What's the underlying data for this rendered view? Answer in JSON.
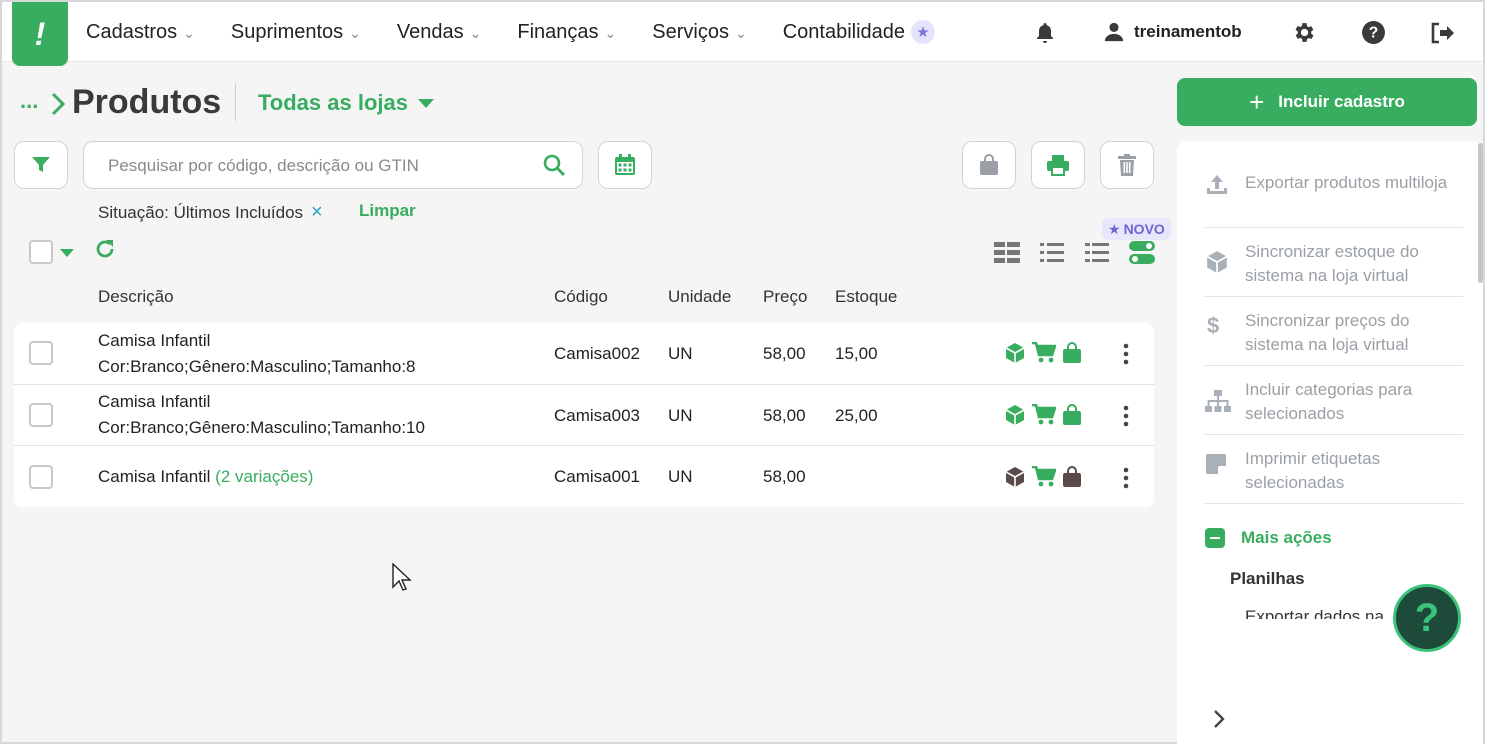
{
  "nav": {
    "logo": "!",
    "menu": [
      {
        "label": "Cadastros"
      },
      {
        "label": "Suprimentos"
      },
      {
        "label": "Vendas"
      },
      {
        "label": "Finanças"
      },
      {
        "label": "Serviços"
      },
      {
        "label": "Contabilidade"
      }
    ],
    "username": "treinamentob"
  },
  "header": {
    "breadcrumb_dots": "...",
    "title": "Produtos",
    "store_select": "Todas as lojas",
    "include_button": "Incluir cadastro"
  },
  "search": {
    "placeholder": "Pesquisar por código, descrição ou GTIN",
    "value": ""
  },
  "filter": {
    "label": "Situação: Últimos Incluídos",
    "remove": "×",
    "clear": "Limpar"
  },
  "badge_new": "NOVO",
  "table": {
    "headers": {
      "description": "Descrição",
      "code": "Código",
      "unit": "Unidade",
      "price": "Preço",
      "stock": "Estoque"
    },
    "rows": [
      {
        "desc1": "Camisa Infantil",
        "desc2": "Cor:Branco;Gênero:Masculino;Tamanho:8",
        "variations": "",
        "code": "Camisa002",
        "unit": "UN",
        "price": "58,00",
        "stock": "15,00"
      },
      {
        "desc1": "Camisa Infantil",
        "desc2": "Cor:Branco;Gênero:Masculino;Tamanho:10",
        "variations": "",
        "code": "Camisa003",
        "unit": "UN",
        "price": "58,00",
        "stock": "25,00"
      },
      {
        "desc1": "Camisa Infantil",
        "desc2": "",
        "variations": "(2 variações)",
        "code": "Camisa001",
        "unit": "UN",
        "price": "58,00",
        "stock": ""
      }
    ]
  },
  "side_panel": {
    "items": [
      {
        "label": "Exportar produtos multiloja",
        "icon": "upload-icon"
      },
      {
        "label": "Sincronizar estoque do sistema na loja virtual",
        "icon": "box-icon"
      },
      {
        "label": "Sincronizar preços do sistema na loja virtual",
        "icon": "dollar-icon"
      },
      {
        "label": "Incluir categorias para selecionados",
        "icon": "sitemap-icon"
      },
      {
        "label": "Imprimir etiquetas selecionadas",
        "icon": "tag-icon"
      }
    ],
    "more_actions": "Mais ações",
    "spreadsheets": "Planilhas",
    "export_data": "Exportar dados na"
  },
  "help_fab": "?",
  "colors": {
    "brand": "#38ad5f",
    "accent_purple": "#7b73d8",
    "muted_text": "#9aa0a6",
    "dark_icon": "#5a4a4a"
  }
}
